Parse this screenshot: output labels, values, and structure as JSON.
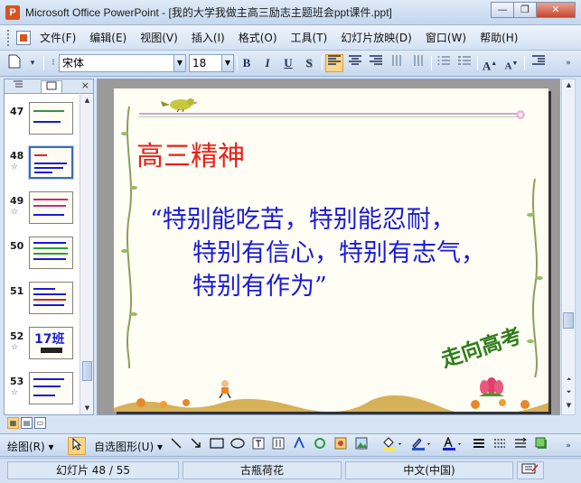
{
  "window": {
    "title": "Microsoft Office PowerPoint - [我的大学我做主高三励志主题班会ppt课件.ppt]",
    "minimize": "—",
    "restore": "❐",
    "close": "✕"
  },
  "menu": {
    "items": [
      "文件(F)",
      "编辑(E)",
      "视图(V)",
      "插入(I)",
      "格式(O)",
      "工具(T)",
      "幻灯片放映(D)",
      "窗口(W)",
      "帮助(H)"
    ]
  },
  "toolbar": {
    "font_name": "宋体",
    "font_size": "18",
    "bold": "B",
    "italic": "I",
    "underline": "U",
    "shadow": "S",
    "increase_font": "A",
    "decrease_font": "A"
  },
  "left_panel": {
    "slides": [
      {
        "number": "47"
      },
      {
        "number": "48"
      },
      {
        "number": "49"
      },
      {
        "number": "50"
      },
      {
        "number": "51"
      },
      {
        "number": "52",
        "thumb_text": "17班"
      },
      {
        "number": "53"
      }
    ],
    "selected": "48",
    "close": "×"
  },
  "slide": {
    "title": "高三精神",
    "body_lines": [
      "“特别能吃苦，特别能忍耐，",
      "特别有信心，特别有志气，",
      "特别有作为”"
    ],
    "stamp_text": "走向高考"
  },
  "drawbar": {
    "draw_label": "绘图(R)",
    "autoshape_label": "自选图形(U)"
  },
  "status": {
    "slide_position": "幻灯片 48 / 55",
    "design_name": "古瓶荷花",
    "language": "中文(中国)"
  },
  "colors": {
    "title_red": "#e8201a",
    "body_blue": "#1a1ad8",
    "stamp_green": "#2e7d1b",
    "highlight": "#fbd68a"
  }
}
